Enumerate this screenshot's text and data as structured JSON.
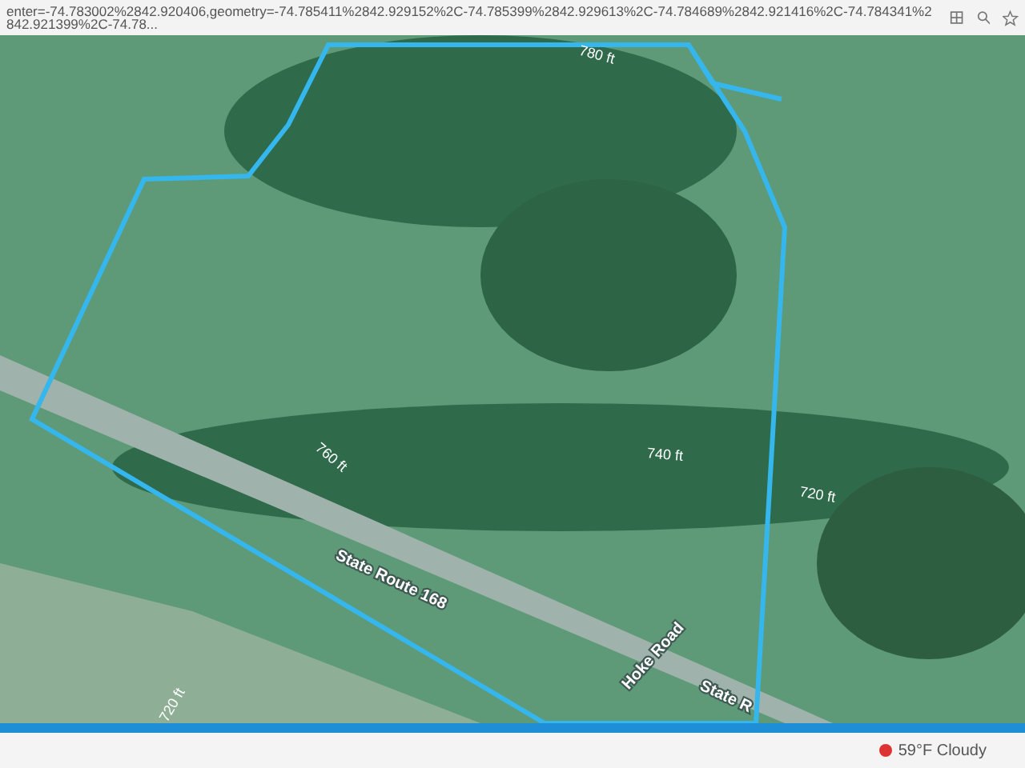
{
  "address_bar": {
    "url": "enter=-74.783002%2842.920406,geometry=-74.785411%2842.929152%2C-74.785399%2842.929613%2C-74.784689%2842.921416%2C-74.784341%2842.921399%2C-74.78..."
  },
  "map": {
    "labels": [
      {
        "text": "780 ft",
        "kind": "contour"
      },
      {
        "text": "760 ft",
        "kind": "contour"
      },
      {
        "text": "740 ft",
        "kind": "contour"
      },
      {
        "text": "720 ft",
        "kind": "contour"
      },
      {
        "text": "State Route 168",
        "kind": "road"
      },
      {
        "text": "Hoke Road",
        "kind": "road"
      },
      {
        "text": "State R",
        "kind": "road"
      },
      {
        "text": "720 ft",
        "kind": "contour"
      }
    ]
  },
  "taskbar": {
    "weather": "59°F Cloudy"
  }
}
